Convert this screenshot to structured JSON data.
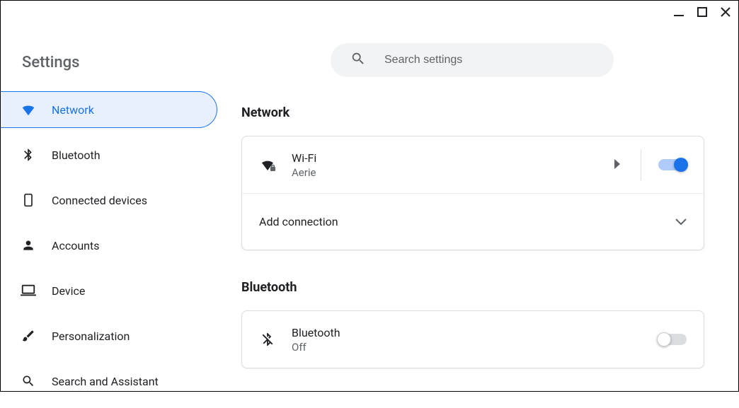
{
  "app_title": "Settings",
  "search": {
    "placeholder": "Search settings"
  },
  "sidebar": {
    "items": [
      {
        "label": "Network",
        "icon": "wifi-icon",
        "active": true
      },
      {
        "label": "Bluetooth",
        "icon": "bluetooth-icon",
        "active": false
      },
      {
        "label": "Connected devices",
        "icon": "phone-icon",
        "active": false
      },
      {
        "label": "Accounts",
        "icon": "person-icon",
        "active": false
      },
      {
        "label": "Device",
        "icon": "laptop-icon",
        "active": false
      },
      {
        "label": "Personalization",
        "icon": "brush-icon",
        "active": false
      },
      {
        "label": "Search and Assistant",
        "icon": "search-icon",
        "active": false
      }
    ]
  },
  "sections": {
    "network": {
      "title": "Network",
      "wifi": {
        "label": "Wi-Fi",
        "ssid": "Aerie",
        "enabled": true
      },
      "add_connection_label": "Add connection"
    },
    "bluetooth": {
      "title": "Bluetooth",
      "item": {
        "label": "Bluetooth",
        "status": "Off",
        "enabled": false
      }
    }
  }
}
